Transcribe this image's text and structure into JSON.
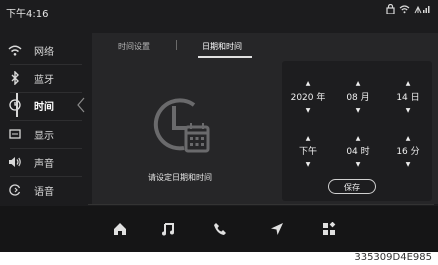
{
  "status": {
    "time": "下午4:16",
    "icons": [
      "lock-icon",
      "wifi-icon",
      "signal-icon"
    ]
  },
  "sidebar": {
    "items": [
      {
        "label": "网络",
        "icon": "wifi-icon"
      },
      {
        "label": "蓝牙",
        "icon": "bluetooth-icon"
      },
      {
        "label": "时间",
        "icon": "clock-icon",
        "active": true
      },
      {
        "label": "显示",
        "icon": "display-icon"
      },
      {
        "label": "声音",
        "icon": "speaker-icon"
      },
      {
        "label": "语音",
        "icon": "voice-icon"
      }
    ]
  },
  "tabs": [
    {
      "label": "时间设置"
    },
    {
      "label": "日期和时间",
      "active": true
    }
  ],
  "main": {
    "prompt": "请设定日期和时间"
  },
  "picker": {
    "year": "2020 年",
    "month": "08 月",
    "day": "14 日",
    "ampm": "下午",
    "hour": "04 时",
    "minute": "16 分",
    "save_label": "保存"
  },
  "dock": {
    "items": [
      "home-icon",
      "music-icon",
      "phone-icon",
      "navigation-icon",
      "apps-icon"
    ]
  },
  "footer": {
    "code": "335309D4E985"
  }
}
